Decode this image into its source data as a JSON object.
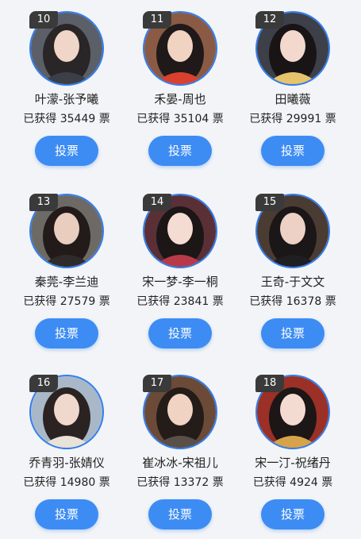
{
  "cards": [
    {
      "rank": "10",
      "name": "叶濛-张予曦",
      "votes": "已获得 35449 票",
      "button": "投票",
      "bg": "#5b5f68",
      "hair": "#2a2526",
      "skin": "#f0d6c8",
      "cloth": "#3c3f48"
    },
    {
      "rank": "11",
      "name": "禾晏-周也",
      "votes": "已获得 35104 票",
      "button": "投票",
      "bg": "#8a5a45",
      "hair": "#1f1919",
      "skin": "#f1d3c2",
      "cloth": "#d9402e"
    },
    {
      "rank": "12",
      "name": "田曦薇",
      "votes": "已获得 29991 票",
      "button": "投票",
      "bg": "#3d3f49",
      "hair": "#191516",
      "skin": "#f3d9cd",
      "cloth": "#e7c46c"
    },
    {
      "rank": "13",
      "name": "秦莞-李兰迪",
      "votes": "已获得 27579 票",
      "button": "投票",
      "bg": "#6d6a66",
      "hair": "#221b1a",
      "skin": "#e9cdbf",
      "cloth": "#2f2b2b"
    },
    {
      "rank": "14",
      "name": "宋一梦-李一桐",
      "votes": "已获得 23841 票",
      "button": "投票",
      "bg": "#5a3036",
      "hair": "#1c1617",
      "skin": "#f5dcd3",
      "cloth": "#b83a48"
    },
    {
      "rank": "15",
      "name": "王奇-于文文",
      "votes": "已获得 16378 票",
      "button": "投票",
      "bg": "#4a3b33",
      "hair": "#1b1617",
      "skin": "#edd1c4",
      "cloth": "#1f1e22"
    },
    {
      "rank": "16",
      "name": "乔青羽-张婧仪",
      "votes": "已获得 14980 票",
      "button": "投票",
      "bg": "#a9b8c8",
      "hair": "#2b2322",
      "skin": "#f1d8cc",
      "cloth": "#e8e2d7"
    },
    {
      "rank": "17",
      "name": "崔冰冰-宋祖儿",
      "votes": "已获得 13372 票",
      "button": "投票",
      "bg": "#6b4a38",
      "hair": "#241c19",
      "skin": "#f0d3c3",
      "cloth": "#5b4f4a"
    },
    {
      "rank": "18",
      "name": "宋一汀-祝绪丹",
      "votes": "已获得 4924 票",
      "button": "投票",
      "bg": "#9b3026",
      "hair": "#1d1616",
      "skin": "#f4dbd2",
      "cloth": "#d7a34a"
    }
  ],
  "colors": {
    "accent": "#3d8cf3",
    "avatar_border": "#2f7df0",
    "rank_badge": "#3a3a3a"
  }
}
